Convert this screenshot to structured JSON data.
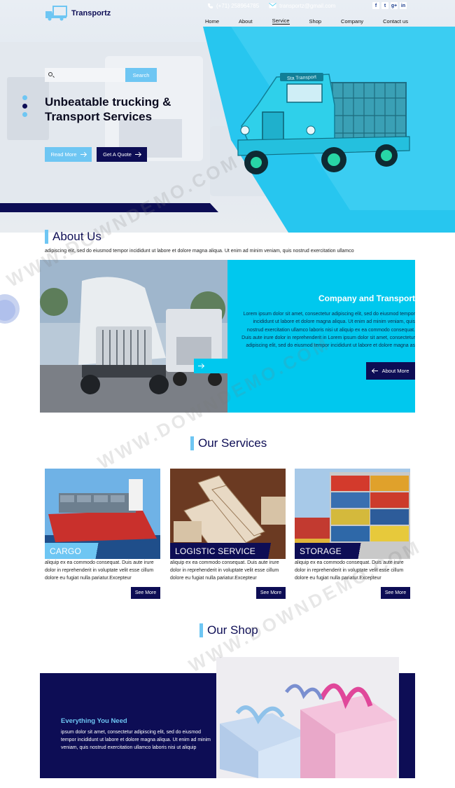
{
  "brand": {
    "name": "Transportz"
  },
  "topbar": {
    "phone": "(+71) 258964785",
    "email": "transportz@gmail.com"
  },
  "social": [
    "f",
    "t",
    "g+",
    "in"
  ],
  "nav": {
    "items": [
      {
        "label": "Home"
      },
      {
        "label": "About"
      },
      {
        "label": "Service"
      },
      {
        "label": "Shop"
      },
      {
        "label": "Company"
      },
      {
        "label": "Contact us"
      }
    ],
    "active": "Service"
  },
  "search": {
    "placeholder": "",
    "button": "Search"
  },
  "hero": {
    "title": "Unbeatable trucking & Transport Services",
    "read_more": "Read More",
    "get_quote": "Get A Quote",
    "truck_sign": "Sta Transport"
  },
  "about": {
    "title": "About Us",
    "intro": "adipiscing elit, sed do eiusmod tempor incididunt ut labore et dolore magna aliqua. Ut enim ad minim veniam, quis nostrud exercitation ullamco",
    "heading": "Company and Transport",
    "paragraph": "Lorem ipsum dolor sit amet, consectetur adipiscing elit, sed do eiusmod tempor incididunt ut labore et dolore magna aliqua. Ut enim ad minim veniam, quis nostrud exercitation ullamco laboris nisi ut aliquip ex ea commodo consequat. Duis aute irure dolor in reprehenderit in Lorem ipsum dolor sit amet, consectetur adipiscing elit, sed do eiusmod tempor incididunt ut labore et dolore magna as",
    "button": "About More"
  },
  "services": {
    "title": "Our Services",
    "items": [
      {
        "label": "CARGO",
        "text": "aliquip ex ea commodo consequat. Duis aute irure dolor in reprehenderit in voluptate velit esse cillum dolore eu fugiat nulla pariatur.Excepteur",
        "button": "See More"
      },
      {
        "label": "LOGISTIC SERVICE",
        "text": "aliquip ex ea commodo consequat. Duis aute irure dolor in reprehenderit in voluptate velit esse cillum dolore eu fugiat nulla pariatur.Excepteur",
        "button": "See More"
      },
      {
        "label": "STORAGE",
        "text": "aliquip ex ea commodo consequat. Duis aute irure dolor in reprehenderit in voluptate velit esse cillum dolore eu fugiat nulla pariatur.Excepteur",
        "button": "See More"
      }
    ]
  },
  "shop": {
    "title": "Our Shop",
    "heading": "Everything You Need",
    "paragraph": "ipsum dolor sit amet, consectetur adipiscing elit, sed do eiusmod tempor incididunt ut labore et dolore magna aliqua. Ut enim ad minim veniam, quis nostrud exercitation ullamco laboris nisi ut aliquip"
  },
  "watermark": "WWW.DOWNDEMO.COM",
  "colors": {
    "navy": "#0d0d55",
    "sky": "#6ec6f3",
    "cyan": "#00c8ee"
  }
}
